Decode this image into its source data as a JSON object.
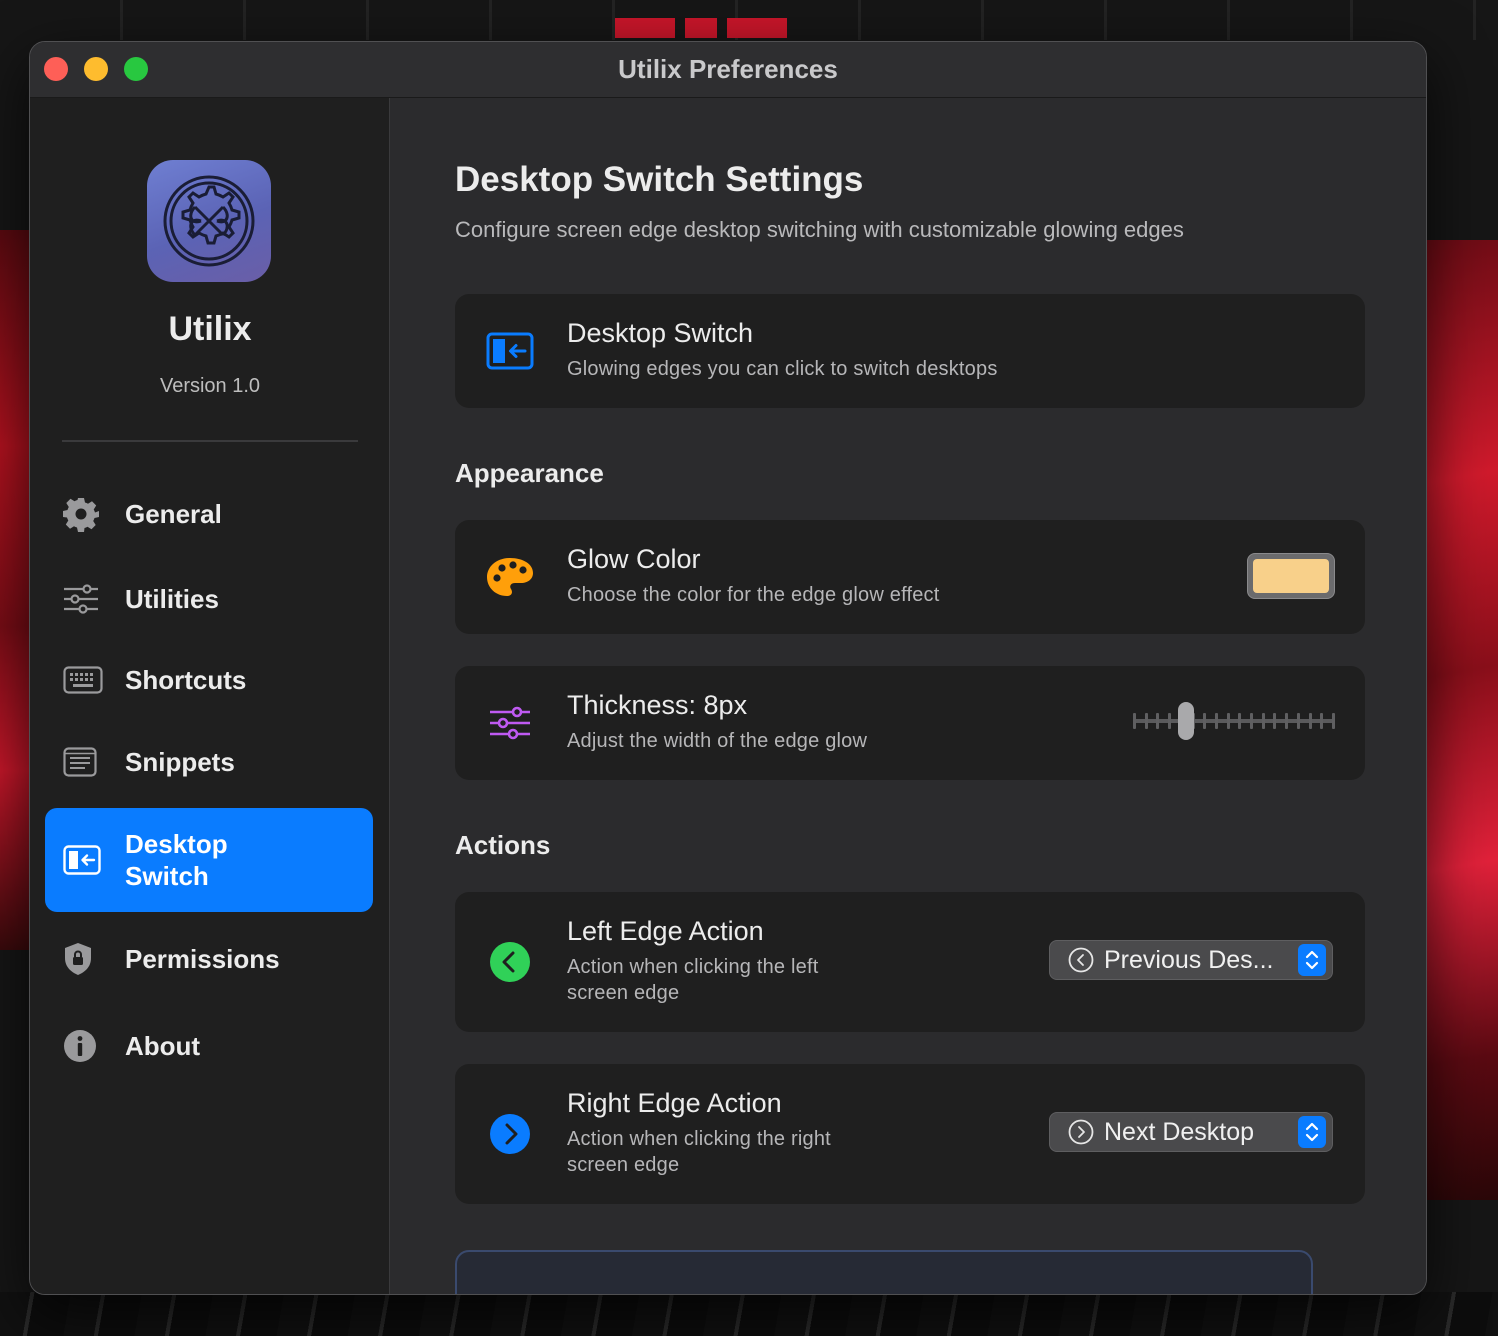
{
  "window": {
    "title": "Utilix Preferences"
  },
  "sidebar": {
    "app_name": "Utilix",
    "version": "Version 1.0",
    "items": [
      {
        "label": "General",
        "icon": "gear-icon"
      },
      {
        "label": "Utilities",
        "icon": "sliders-icon"
      },
      {
        "label": "Shortcuts",
        "icon": "keyboard-icon"
      },
      {
        "label": "Snippets",
        "icon": "document-icon"
      },
      {
        "label": "Desktop Switch",
        "icon": "desktop-switch-icon",
        "active": true
      },
      {
        "label": "Permissions",
        "icon": "shield-icon"
      },
      {
        "label": "About",
        "icon": "info-icon"
      }
    ]
  },
  "main": {
    "title": "Desktop Switch Settings",
    "subtitle": "Configure screen edge desktop switching with customizable glowing edges",
    "feature_card": {
      "title": "Desktop Switch",
      "description": "Glowing edges you can click to switch desktops"
    },
    "appearance": {
      "section_title": "Appearance",
      "glow_color": {
        "title": "Glow Color",
        "description": "Choose the color for the edge glow effect",
        "value": "#f8d08a"
      },
      "thickness": {
        "title": "Thickness: 8px",
        "description": "Adjust the width of the edge glow",
        "value": 8,
        "min": 1,
        "max": 30
      }
    },
    "actions": {
      "section_title": "Actions",
      "left_edge": {
        "title": "Left Edge Action",
        "description": "Action when clicking the left screen edge",
        "selected": "Previous Des..."
      },
      "right_edge": {
        "title": "Right Edge Action",
        "description": "Action when clicking the right screen edge",
        "selected": "Next Desktop"
      }
    }
  },
  "colors": {
    "accent": "#0a7cff",
    "palette_orange": "#ff9f0a",
    "sliders_purple": "#bf5af2",
    "left_green": "#30d158",
    "right_blue": "#0a7cff"
  }
}
